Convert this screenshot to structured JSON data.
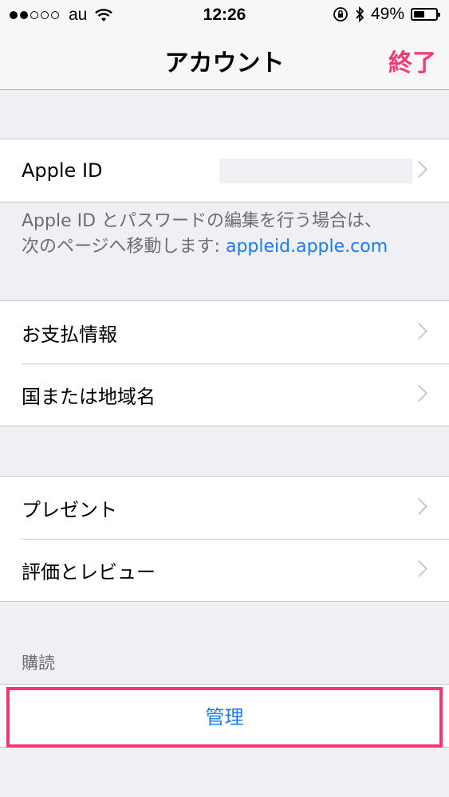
{
  "status_bar": {
    "carrier": "au",
    "time": "12:26",
    "battery": "49%",
    "battery_level": 0.49,
    "signal_strength": 2,
    "signal_total": 5
  },
  "nav": {
    "title": "アカウント",
    "done_label": "終了"
  },
  "apple_id": {
    "label": "Apple ID",
    "note_line1": "Apple ID とパスワードの編集を行う場合は、",
    "note_line2_prefix": "次のページへ移動します: ",
    "note_link": "appleid.apple.com"
  },
  "payment_group": {
    "items": [
      {
        "label": "お支払情報"
      },
      {
        "label": "国または地域名"
      }
    ]
  },
  "gift_group": {
    "items": [
      {
        "label": "プレゼント"
      },
      {
        "label": "評価とレビュー"
      }
    ]
  },
  "subscriptions": {
    "header": "購読",
    "manage_label": "管理"
  },
  "colors": {
    "accent_pink": "#fb3770",
    "link_blue": "#1a7cf5",
    "background": "#efeff4"
  }
}
